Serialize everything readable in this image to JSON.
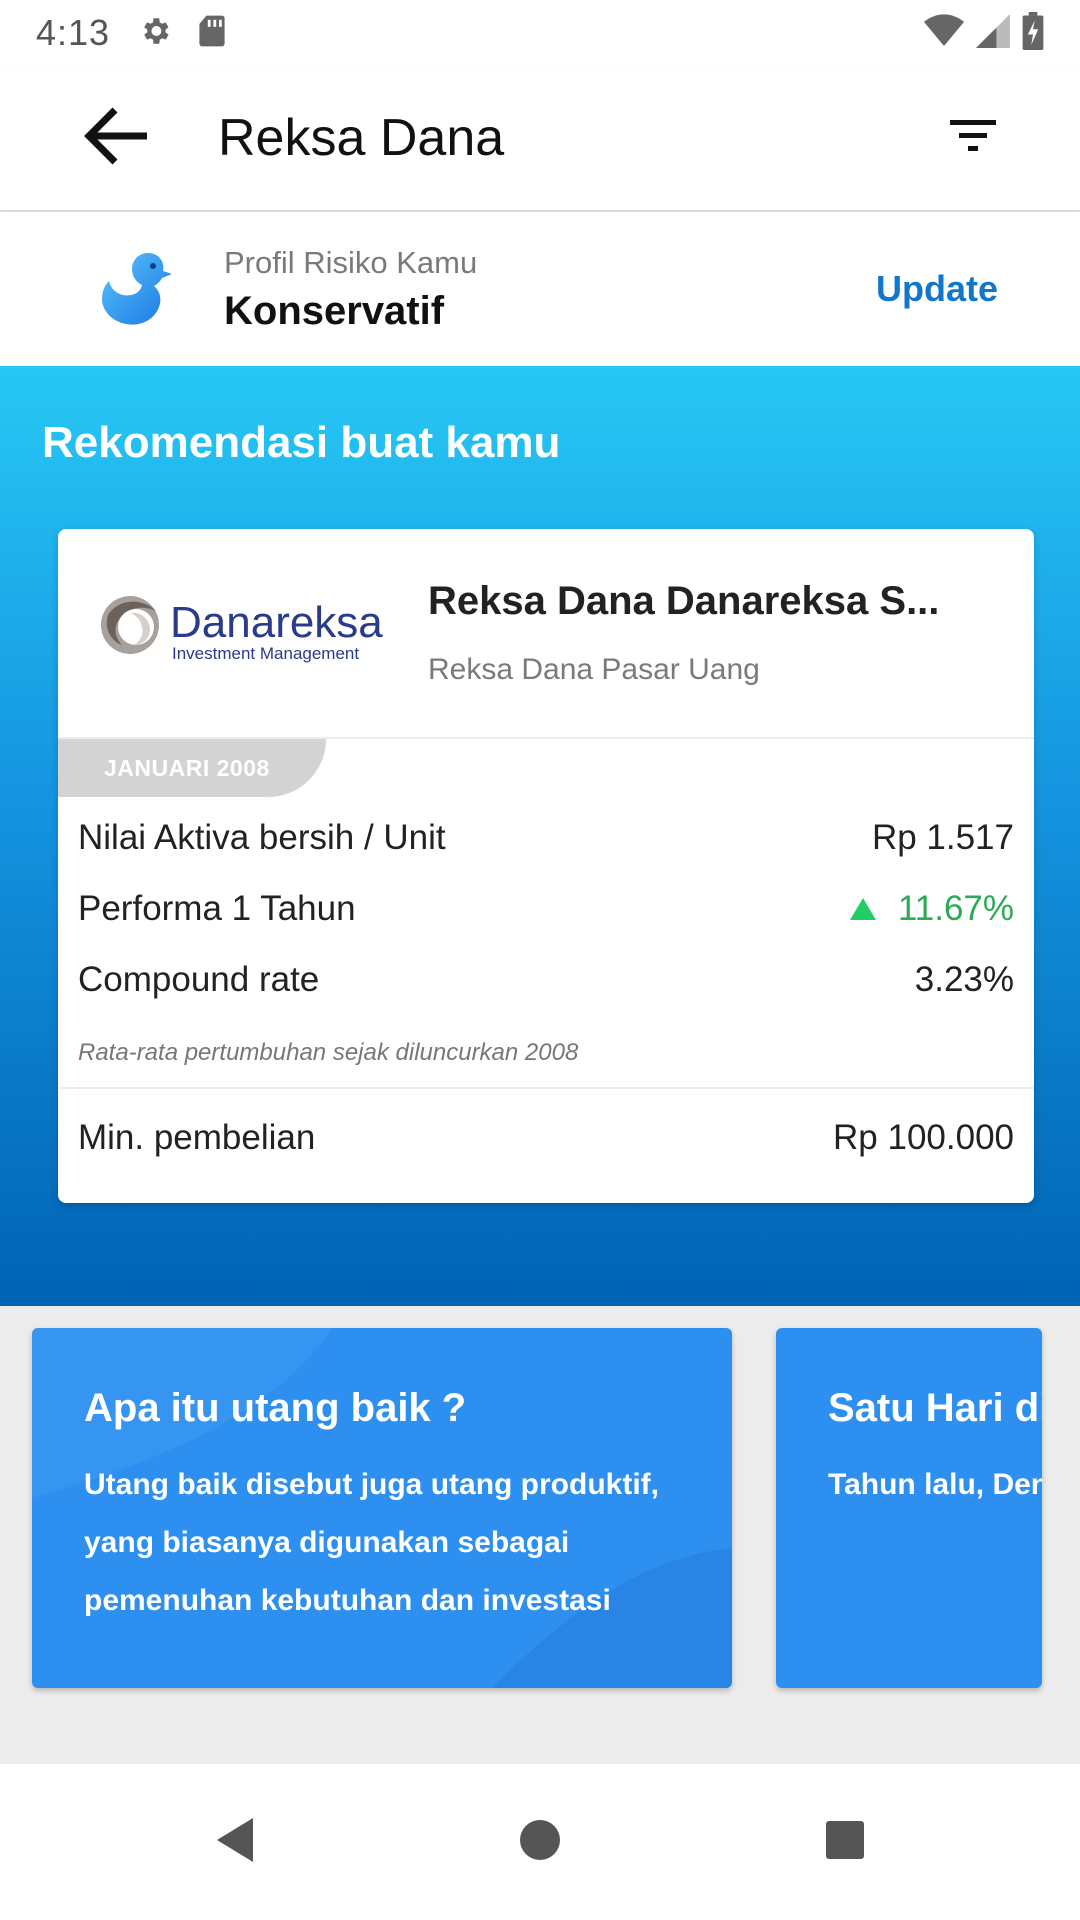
{
  "status_bar": {
    "time": "4:13",
    "icons": [
      "gear-icon",
      "sd-card-icon",
      "wifi-icon",
      "signal-icon",
      "battery-icon"
    ]
  },
  "app_bar": {
    "title": "Reksa Dana",
    "back_icon": "arrow-left-icon",
    "filter_icon": "filter-icon"
  },
  "risk_profile": {
    "label": "Profil Risiko Kamu",
    "value": "Konservatif",
    "update_label": "Update",
    "avatar_icon": "duck-icon"
  },
  "recommendation": {
    "title": "Rekomendasi buat kamu",
    "fund": {
      "logo_name": "Danareksa",
      "logo_tagline": "Investment Management",
      "name": "Reksa Dana Danareksa S...",
      "type": "Reksa Dana Pasar Uang",
      "date_tag": "JANUARI 2008",
      "nav_label": "Nilai Aktiva bersih / Unit",
      "nav_value": "Rp 1.517",
      "perf_label": "Performa 1 Tahun",
      "perf_value": "11.67%",
      "compound_label": "Compound rate",
      "compound_value": "3.23%",
      "note": "Rata-rata pertumbuhan sejak diluncurkan 2008",
      "min_label": "Min. pembelian",
      "min_value": "Rp 100.000"
    }
  },
  "articles": [
    {
      "title": "Apa itu utang baik ?",
      "body": "Utang baik disebut juga utang produktif, yang biasanya digunakan sebagai pemenuhan kebutuhan dan investasi"
    },
    {
      "title": "Satu Hari di",
      "body": "Tahun lalu, Den Festival"
    }
  ],
  "nav_bar": {
    "icons": [
      "back-triangle-icon",
      "home-circle-icon",
      "recents-square-icon"
    ]
  },
  "colors": {
    "accent": "#1177cc",
    "positive": "#2daa55",
    "gradient_top": "#27c8f5",
    "gradient_bottom": "#0063b4",
    "article_bg": "#2d8ff0"
  }
}
